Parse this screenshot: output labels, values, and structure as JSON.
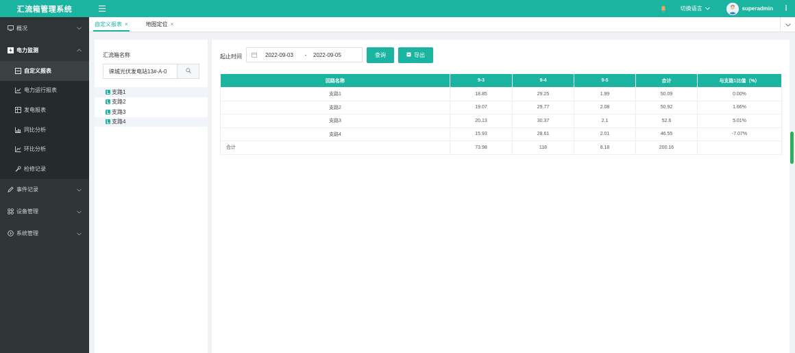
{
  "app": {
    "title": "汇流箱管理系统"
  },
  "header": {
    "language_label": "切换语言",
    "username": "superadmin"
  },
  "sidebar": {
    "groups": [
      {
        "label": "概况",
        "icon": "monitor-icon",
        "active": false
      },
      {
        "label": "电力监测",
        "icon": "power-icon",
        "active": true
      }
    ],
    "sub_items": [
      {
        "label": "自定义报表",
        "icon": "report-icon",
        "active": true
      },
      {
        "label": "电力运行报表",
        "icon": "chart-icon",
        "active": false
      },
      {
        "label": "发电报表",
        "icon": "table-icon",
        "active": false
      },
      {
        "label": "同比分析",
        "icon": "chart-icon",
        "active": false
      },
      {
        "label": "环比分析",
        "icon": "chart-icon",
        "active": false
      },
      {
        "label": "检修记录",
        "icon": "wrench-icon",
        "active": false
      }
    ],
    "groups_after": [
      {
        "label": "事件记录",
        "icon": "edit-icon"
      },
      {
        "label": "设备管理",
        "icon": "grid-icon"
      },
      {
        "label": "系统管理",
        "icon": "settings-icon"
      }
    ]
  },
  "tabs": [
    {
      "label": "自定义报表",
      "active": true
    },
    {
      "label": "地图定位",
      "active": false
    }
  ],
  "left_panel": {
    "label": "汇流箱名称",
    "input_value": "徕城光伏发电站13#-A-0",
    "tree": [
      {
        "label": "支路1",
        "highlight": true
      },
      {
        "label": "支路2",
        "highlight": false
      },
      {
        "label": "支路3",
        "highlight": false
      },
      {
        "label": "支路4",
        "highlight": true
      }
    ]
  },
  "main": {
    "date_label": "起止时间",
    "date_start": "2022-09-03",
    "date_sep": "-",
    "date_end": "2022-09-05",
    "query_label": "查询",
    "export_label": "导出"
  },
  "table": {
    "headers": [
      "回路名称",
      "9-3",
      "9-4",
      "9-5",
      "合计",
      "与支路1比值（%）"
    ],
    "rows": [
      [
        "支路1",
        "18.85",
        "29.25",
        "1.99",
        "50.09",
        "0.00%"
      ],
      [
        "支路2",
        "19.07",
        "29.77",
        "2.08",
        "50.92",
        "1.66%"
      ],
      [
        "支路3",
        "20.13",
        "30.37",
        "2.1",
        "52.6",
        "5.01%"
      ],
      [
        "支路4",
        "15.93",
        "28.61",
        "2.01",
        "46.55",
        "-7.07%"
      ],
      [
        "合计",
        "73.98",
        "118",
        "8.18",
        "200.16",
        ""
      ]
    ]
  },
  "colors": {
    "accent": "#1bb4a0",
    "sidebar": "#2f3536"
  }
}
